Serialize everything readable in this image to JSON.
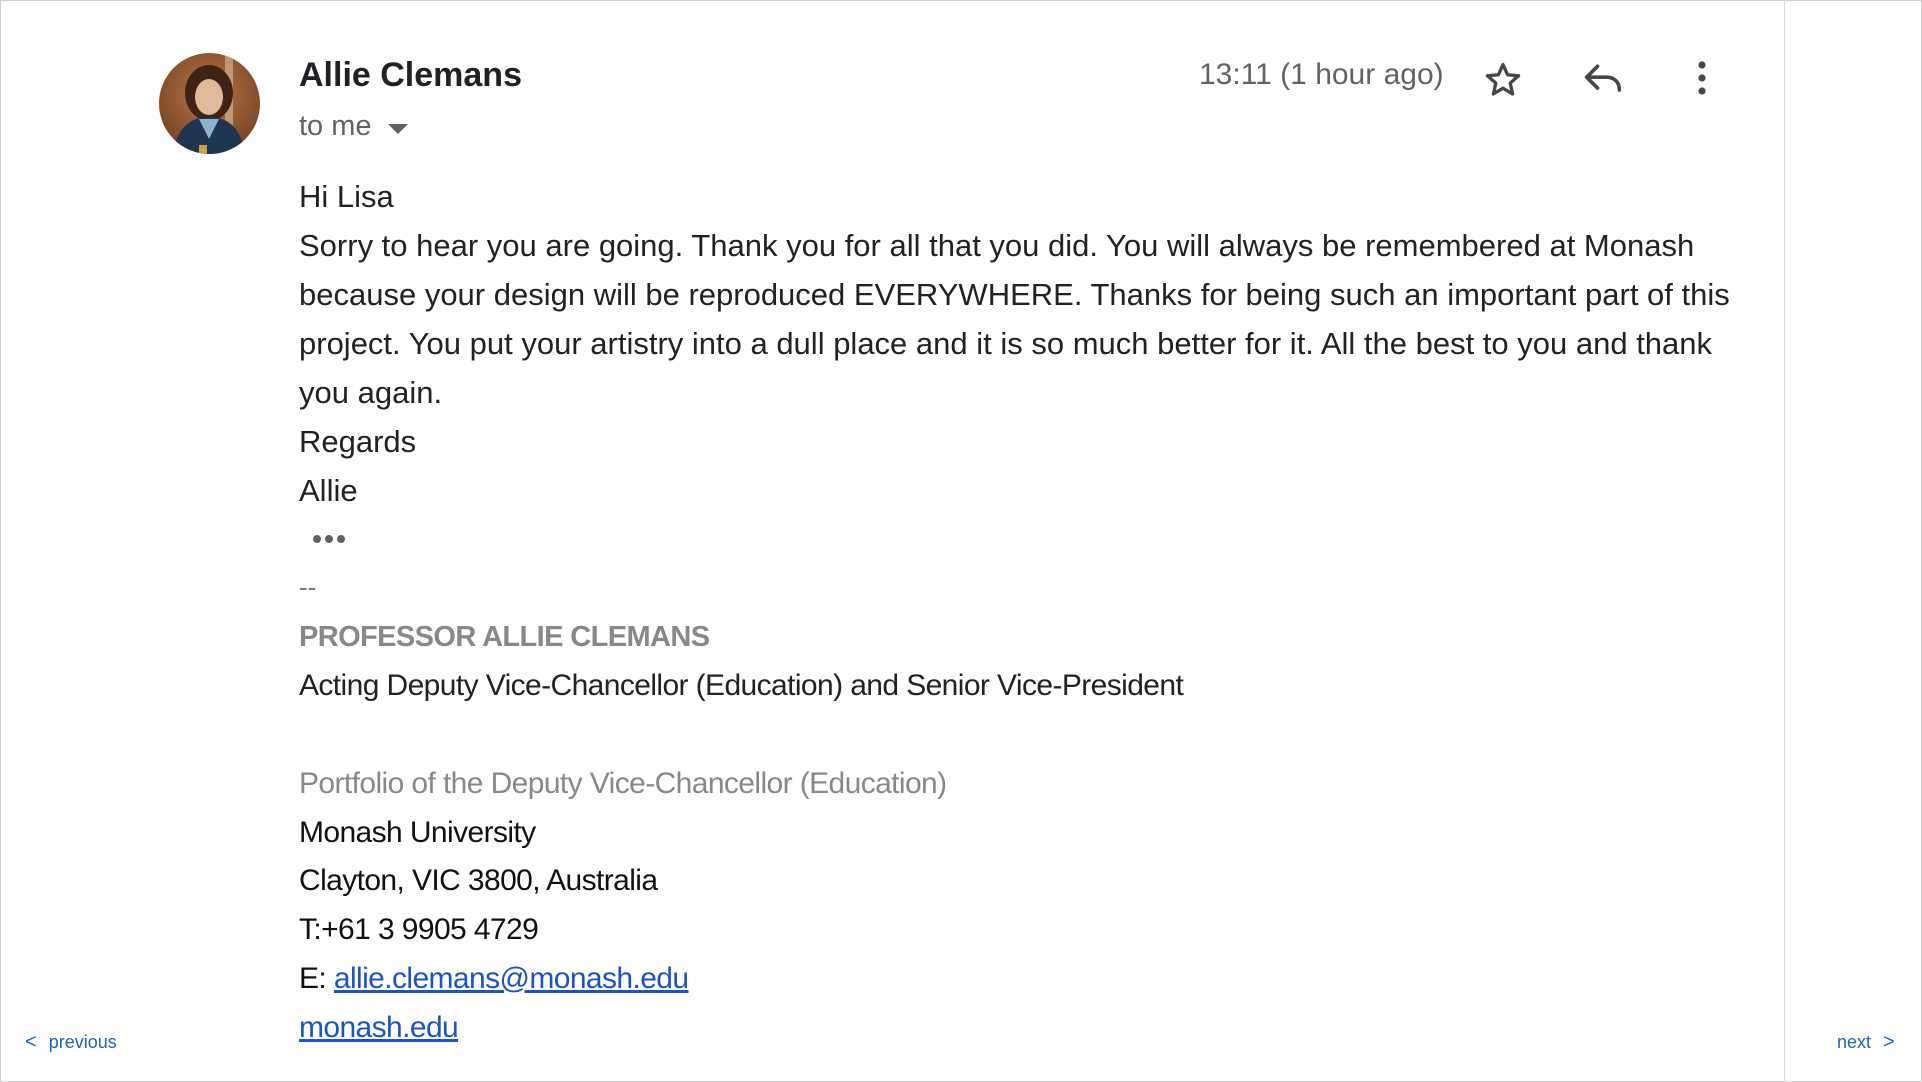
{
  "header": {
    "sender_name": "Allie Clemans",
    "recipient_label": "to me",
    "timestamp": "13:11 (1 hour ago)"
  },
  "icons": {
    "avatar": "avatar",
    "star": "star-icon",
    "reply": "reply-icon",
    "more": "more-vertical-icon",
    "recipient_dropdown": "chevron-down-icon",
    "trimmed_content": "ellipsis-icon"
  },
  "message": {
    "greeting": "Hi Lisa",
    "paragraph": "Sorry to hear you are going. Thank you for all that you did. You will always be remembered at Monash because your design will be reproduced EVERYWHERE. Thanks for being such an important part of this project. You put your artistry into a dull place and it is so much better for it. All the best to you and thank you again.",
    "closing": "Regards",
    "signoff": "Allie"
  },
  "signature": {
    "separator": "--",
    "name": "PROFESSOR ALLIE CLEMANS",
    "title": "Acting Deputy Vice-Chancellor (Education) and Senior Vice-President",
    "portfolio": "Portfolio of the Deputy Vice-Chancellor (Education)",
    "university": "Monash University",
    "address": "Clayton, VIC 3800, Australia",
    "phone": "T:+61 3 9905 4729",
    "email_prefix": "E: ",
    "email": "allie.clemans@monash.edu",
    "website": "monash.edu"
  },
  "navigation": {
    "previous_label": "previous",
    "next_label": "next",
    "previous_chevron": "<",
    "next_chevron": ">"
  },
  "colors": {
    "link": "#1a55c4",
    "nav_link": "#1a66b8",
    "muted_text": "#5f6368",
    "signature_grey": "#888888"
  }
}
